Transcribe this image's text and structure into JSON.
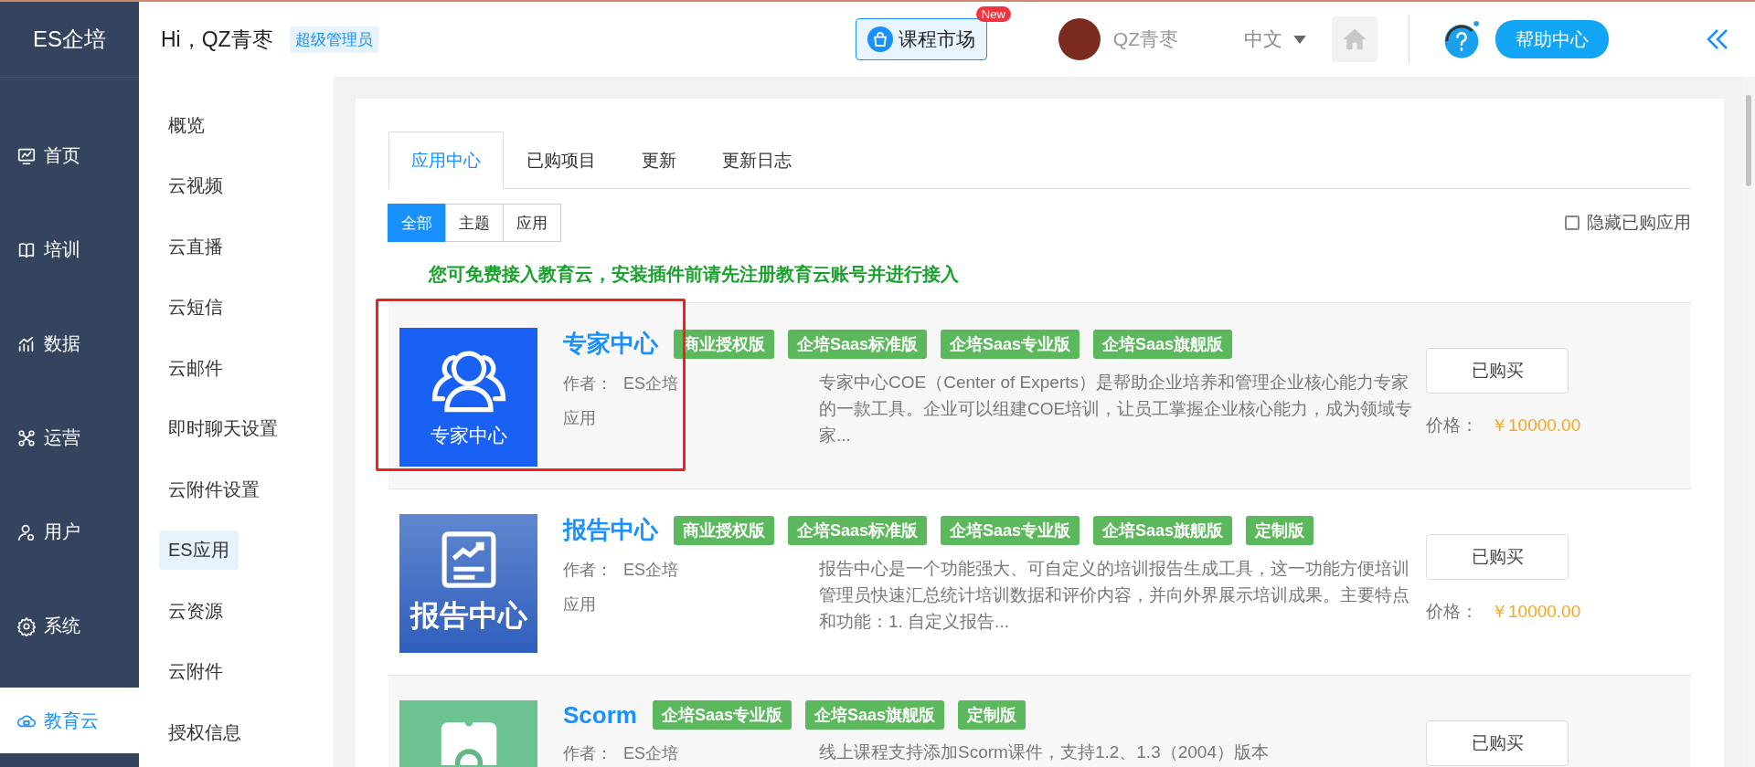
{
  "brand": "ES企培",
  "sidebar": {
    "items": [
      {
        "label": "首页",
        "kind": "monitor",
        "selected": false
      },
      {
        "label": "培训",
        "kind": "training",
        "selected": false
      },
      {
        "label": "数据",
        "kind": "chart",
        "selected": false
      },
      {
        "label": "运营",
        "kind": "nodes",
        "selected": false
      },
      {
        "label": "用户",
        "kind": "user",
        "selected": false
      },
      {
        "label": "系统",
        "kind": "gear",
        "selected": false
      },
      {
        "label": "教育云",
        "kind": "cloud",
        "selected": true
      }
    ]
  },
  "submenu": [
    {
      "label": "概览",
      "selected": false
    },
    {
      "label": "云视频",
      "selected": false
    },
    {
      "label": "云直播",
      "selected": false
    },
    {
      "label": "云短信",
      "selected": false
    },
    {
      "label": "云邮件",
      "selected": false
    },
    {
      "label": "即时聊天设置",
      "selected": false
    },
    {
      "label": "云附件设置",
      "selected": false
    },
    {
      "label": "ES应用",
      "selected": true
    },
    {
      "label": "云资源",
      "selected": false
    },
    {
      "label": "云附件",
      "selected": false
    },
    {
      "label": "授权信息",
      "selected": false
    }
  ],
  "header": {
    "greeting": "Hi，QZ青枣",
    "role": "超级管理员",
    "market": {
      "label": "课程市场",
      "badge": "New"
    },
    "user": "QZ青枣",
    "language": "中文",
    "help": "帮助中心"
  },
  "tabs": [
    {
      "label": "应用中心",
      "selected": true
    },
    {
      "label": "已购项目",
      "selected": false
    },
    {
      "label": "更新",
      "selected": false
    },
    {
      "label": "更新日志",
      "selected": false
    }
  ],
  "filters": [
    {
      "label": "全部",
      "selected": true
    },
    {
      "label": "主题",
      "selected": false
    },
    {
      "label": "应用",
      "selected": false
    }
  ],
  "hide_purchased": {
    "label": "隐藏已购应用",
    "checked": false
  },
  "notice": "您可免费接入教育云，安装插件前请先注册教育云账号并进行接入",
  "apps": [
    {
      "icon": {
        "kind": "experts",
        "caption": "专家中心"
      },
      "title": "专家中心",
      "tags": [
        "商业授权版",
        "企培Saas标准版",
        "企培Saas专业版",
        "企培Saas旗舰版"
      ],
      "author_label": "作者：",
      "author": "ES企培",
      "type": "应用",
      "description": "专家中心COE（Center of Experts）是帮助企业培养和管理企业核心能力专家的一款工具。企业可以组建COE培训，让员工掌握企业核心能力，成为领域专家...",
      "button": "已购买",
      "price_label": "价格：",
      "price": "￥10000.00",
      "annotated": true
    },
    {
      "icon": {
        "kind": "report",
        "caption": "报告中心"
      },
      "title": "报告中心",
      "tags": [
        "商业授权版",
        "企培Saas标准版",
        "企培Saas专业版",
        "企培Saas旗舰版",
        "定制版"
      ],
      "author_label": "作者：",
      "author": "ES企培",
      "type": "应用",
      "description": "报告中心是一个功能强大、可自定义的培训报告生成工具，这一功能方便培训管理员快速汇总统计培训数据和评价内容，并向外界展示培训成果。主要特点和功能：1. 自定义报告...",
      "button": "已购买",
      "price_label": "价格：",
      "price": "￥10000.00",
      "annotated": false
    },
    {
      "icon": {
        "kind": "scorm"
      },
      "title": "Scorm",
      "tags": [
        "企培Saas专业版",
        "企培Saas旗舰版",
        "定制版"
      ],
      "author_label": "作者：",
      "author": "ES企培",
      "description": "线上课程支持添加Scorm课件，支持1.2、1.3（2004）版本",
      "button": "已购买",
      "annotated": false
    }
  ]
}
